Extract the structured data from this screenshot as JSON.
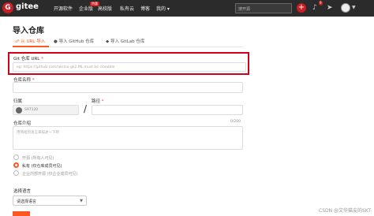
{
  "topbar": {
    "brand": "gitee",
    "nav": [
      "开源软件",
      "企业版",
      "高校版",
      "私有云",
      "博客",
      "我的 ▾"
    ],
    "hot_badge": "特惠",
    "search_placeholder": "搜开源",
    "notification_count": "9"
  },
  "page": {
    "title": "导入仓库"
  },
  "tabs": [
    {
      "label": "从 URL 导入",
      "icon": "link-icon"
    },
    {
      "label": "导入 GitHub 仓库",
      "icon": "github-icon"
    },
    {
      "label": "导入 GitLab 仓库",
      "icon": "gitlab-icon"
    }
  ],
  "form": {
    "git_url_label": "Git 仓库 URL",
    "git_url_placeholder": "eg: https://github.com/rwsl/ui-gk2.ML  must be clonable",
    "repo_name_label": "仓库名称",
    "owner_label": "归属",
    "owner_value": "S97120",
    "path_label": "路径",
    "intro_label": "仓库介绍",
    "intro_counter": "0/200",
    "intro_placeholder": "用简短的语言来描述一下吧",
    "visibility": [
      {
        "label": "开源  (所有人可见)",
        "selected": false
      },
      {
        "label": "私有  (仅仓库成员可见)",
        "selected": true
      },
      {
        "label": "企业内部开源  (仅企业成员可见)",
        "selected": false
      }
    ],
    "language_label": "选择语言",
    "language_value": "请选择语言"
  },
  "watermark": "CSDN @文华猫友的SKT",
  "colors": {
    "accent": "#ff5722",
    "brand": "#c71d23",
    "highlight": "#d0021b"
  }
}
